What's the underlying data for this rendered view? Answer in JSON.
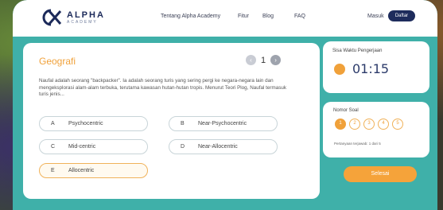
{
  "brand": {
    "title": "ALPHA",
    "subtitle": "ACADEMY"
  },
  "nav": {
    "about": "Tentang Alpha Academy",
    "features": "Fitur",
    "blog": "Blog",
    "faq": "FAQ"
  },
  "auth": {
    "login": "Masuk",
    "register": "Daftar"
  },
  "quiz": {
    "subject": "Geografi",
    "page": "1",
    "prev_icon": "chevron-left-icon",
    "next_icon": "chevron-right-icon",
    "question": "Naufal adalah seorang \"backpacker\". Ia adalah seorang turis yang sering pergi ke negara-negara lain dan mengeksplorasi alam-alam terbuka, terutama kawasan hutan-hutan tropis. Menurut Teori Plog, Naufal termasuk turis jenis...",
    "options": [
      {
        "letter": "A",
        "text": "Psychocentric"
      },
      {
        "letter": "B",
        "text": "Near-Psychocentric"
      },
      {
        "letter": "C",
        "text": "Mid-centric"
      },
      {
        "letter": "D",
        "text": "Near-Allocentric"
      },
      {
        "letter": "E",
        "text": "Allocentric",
        "selected": true
      }
    ]
  },
  "timer": {
    "label": "Sisa Waktu Pengerjaan",
    "value": "01:15"
  },
  "numbers": {
    "label": "Nomor Soal",
    "items": [
      "1",
      "2",
      "3",
      "4",
      "5"
    ],
    "active": "1",
    "answered": "Pertanyaan terjawab: 1 dari 5"
  },
  "finish_label": "Selesai",
  "colors": {
    "accent": "#f0a13a",
    "teal": "#3fb0a9",
    "navy": "#1e2c5c"
  }
}
